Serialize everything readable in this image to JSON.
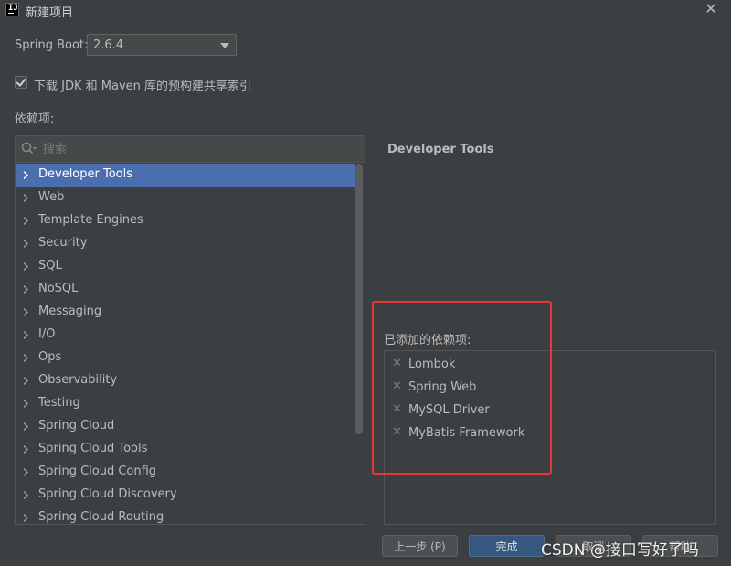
{
  "window": {
    "title": "新建项目",
    "app_icon_text": "IJ"
  },
  "spring_boot": {
    "label": "Spring Boot:",
    "value": "2.6.4"
  },
  "download_option": {
    "checked": true,
    "label": "下载 JDK 和 Maven 库的预构建共享索引"
  },
  "dependencies": {
    "label": "依赖项:",
    "search_placeholder": "搜索",
    "categories": [
      {
        "label": "Developer Tools",
        "selected": true
      },
      {
        "label": "Web"
      },
      {
        "label": "Template Engines"
      },
      {
        "label": "Security"
      },
      {
        "label": "SQL"
      },
      {
        "label": "NoSQL"
      },
      {
        "label": "Messaging"
      },
      {
        "label": "I/O"
      },
      {
        "label": "Ops"
      },
      {
        "label": "Observability"
      },
      {
        "label": "Testing"
      },
      {
        "label": "Spring Cloud"
      },
      {
        "label": "Spring Cloud Tools"
      },
      {
        "label": "Spring Cloud Config"
      },
      {
        "label": "Spring Cloud Discovery"
      },
      {
        "label": "Spring Cloud Routing"
      }
    ]
  },
  "detail": {
    "title": "Developer Tools"
  },
  "added": {
    "label": "已添加的依赖项:",
    "items": [
      "Lombok",
      "Spring Web",
      "MySQL Driver",
      "MyBatis Framework"
    ]
  },
  "buttons": {
    "prev": "上一步 (P)",
    "finish": "完成",
    "cancel": "取消",
    "help": "帮助"
  },
  "watermark": "CSDN @接口写好了吗",
  "colors": {
    "background": "#3c3f41",
    "selection": "#4b6eaf",
    "primary_button": "#365880",
    "highlight_box": "#e53935"
  }
}
